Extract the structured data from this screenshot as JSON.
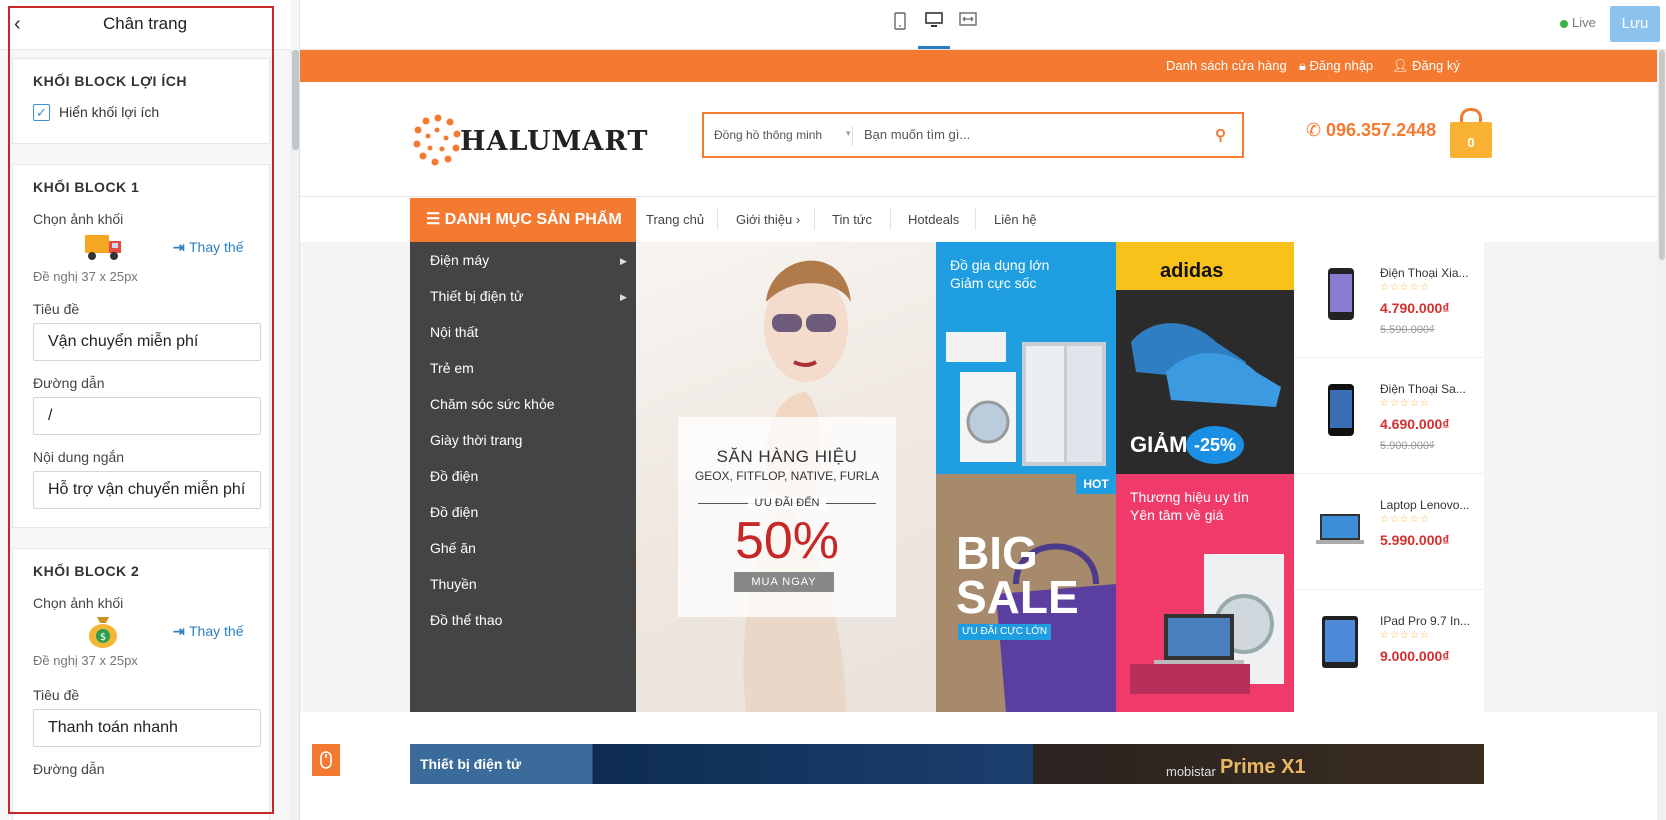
{
  "panel": {
    "title": "Chân trang",
    "benefit": {
      "heading": "KHỐI BLOCK LỢI ÍCH",
      "show_label": "Hiển khối lợi ích"
    },
    "block1": {
      "heading": "KHỐI BLOCK 1",
      "image_label": "Chọn ảnh khối",
      "replace_label": "Thay thế",
      "hint": "Đề nghị 37 x 25px",
      "title_label": "Tiêu đề",
      "title_value": "Vận chuyển miễn phí",
      "link_label": "Đường dẫn",
      "link_value": "/",
      "short_label": "Nội dung ngắn",
      "short_value": "Hỗ trợ vận chuyển miễn phí"
    },
    "block2": {
      "heading": "KHỐI BLOCK 2",
      "image_label": "Chọn ảnh khối",
      "replace_label": "Thay thế",
      "hint": "Đề nghị 37 x 25px",
      "title_label": "Tiêu đề",
      "title_value": "Thanh toán nhanh",
      "link_label": "Đường dẫn"
    }
  },
  "topbar": {
    "live_label": "Live",
    "save_label": "Lưu"
  },
  "site": {
    "toplinks": [
      "Danh sách cửa hàng",
      "Đăng nhập",
      "Đăng ký"
    ],
    "logo": "HALUMART",
    "search_category": "Đồng hồ thông minh",
    "search_placeholder": "Bạn muốn tìm gì...",
    "phone": "096.357.2448",
    "cart_count": "0",
    "category_button": "DANH MỤC SẢN PHẨM",
    "nav": [
      "Trang chủ",
      "Giới thiệu",
      "Tin tức",
      "Hotdeals",
      "Liên hệ"
    ],
    "nav_caret": "›",
    "categories": [
      "Điện máy",
      "Thiết bị điện tử",
      "Nội thất",
      "Trẻ em",
      "Chăm sóc sức khỏe",
      "Giày thời trang",
      "Đồ điện",
      "Đồ điện",
      "Ghế ăn",
      "Thuyền",
      "Đồ thể thao"
    ],
    "hero": {
      "title": "SĂN HÀNG HIỆU",
      "brands": "GEOX, FITFLOP, NATIVE, FURLA",
      "offer": "ƯU ĐÃI ĐẾN",
      "percent": "50%",
      "cta": "MUA NGAY"
    },
    "tiles": {
      "t1": "Đồ gia dụng lớn\nGiảm cực sốc",
      "t2_brand": "adidas",
      "t2_sale": "GIẢM",
      "t2_pct": "-25%",
      "t3_hot": "HOT",
      "t3_big": "BIG",
      "t3_sale": "SALE",
      "t3_sub": "ƯU ĐÃI CỰC LỚN",
      "t4": "Thương hiệu uy tín\nYên tâm về giá"
    },
    "products": [
      {
        "name": "Điện Thoại Xia...",
        "stars": "☆☆☆☆☆",
        "price": "4.790.000₫",
        "old": "5.590.000₫"
      },
      {
        "name": "Điện Thoại Sa...",
        "stars": "☆☆☆☆☆",
        "price": "4.690.000₫",
        "old": "5.900.000₫"
      },
      {
        "name": "Laptop Lenovo...",
        "stars": "☆☆☆☆☆",
        "price": "5.990.000₫",
        "old": ""
      },
      {
        "name": "IPad Pro 9.7 In...",
        "stars": "☆☆☆☆☆",
        "price": "9.000.000₫",
        "old": ""
      }
    ],
    "bottom": {
      "section": "Thiết bị điện tử",
      "promo_small": "mobistar",
      "promo_big": "Prime X1"
    }
  },
  "colors": {
    "accent": "#f47a32",
    "link": "#2a7fc0",
    "highlight": "#c62828"
  }
}
